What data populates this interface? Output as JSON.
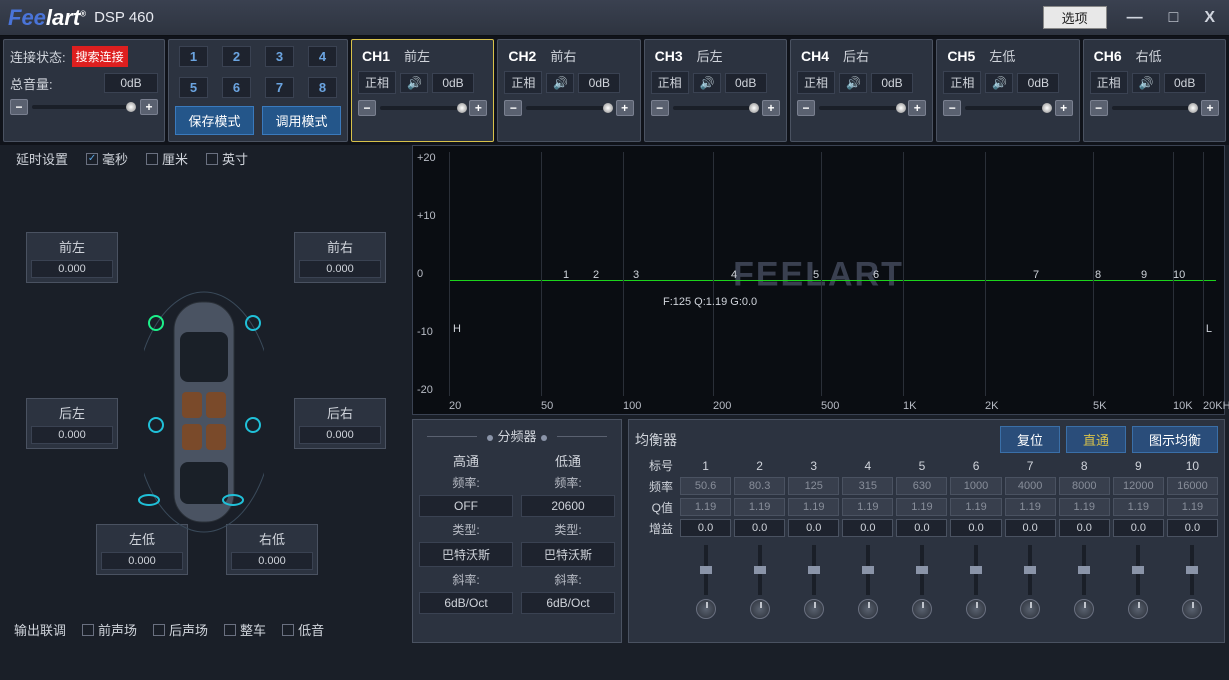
{
  "app": {
    "brand_a": "Fee",
    "brand_b": "lart",
    "product": "DSP 460",
    "options": "选项"
  },
  "win": {
    "min": "—",
    "max": "□",
    "close": "X"
  },
  "status": {
    "label": "连接状态:",
    "search": "搜索连接",
    "vol_label": "总音量:",
    "vol_value": "0dB"
  },
  "presets": {
    "nums": [
      "1",
      "2",
      "3",
      "4",
      "5",
      "6",
      "7",
      "8"
    ],
    "save": "保存模式",
    "recall": "调用模式"
  },
  "channels": [
    {
      "id": "CH1",
      "name": "前左",
      "phase": "正相",
      "db": "0dB",
      "selected": true
    },
    {
      "id": "CH2",
      "name": "前右",
      "phase": "正相",
      "db": "0dB",
      "selected": false
    },
    {
      "id": "CH3",
      "name": "后左",
      "phase": "正相",
      "db": "0dB",
      "selected": false
    },
    {
      "id": "CH4",
      "name": "后右",
      "phase": "正相",
      "db": "0dB",
      "selected": false
    },
    {
      "id": "CH5",
      "name": "左低",
      "phase": "正相",
      "db": "0dB",
      "selected": false
    },
    {
      "id": "CH6",
      "name": "右低",
      "phase": "正相",
      "db": "0dB",
      "selected": false
    }
  ],
  "delay": {
    "title": "延时设置",
    "units": {
      "ms": "毫秒",
      "cm": "厘米",
      "inch": "英寸",
      "selected": "ms"
    },
    "speakers": {
      "fl": {
        "name": "前左",
        "value": "0.000"
      },
      "fr": {
        "name": "前右",
        "value": "0.000"
      },
      "rl": {
        "name": "后左",
        "value": "0.000"
      },
      "rr": {
        "name": "后右",
        "value": "0.000"
      },
      "ll": {
        "name": "左低",
        "value": "0.000"
      },
      "lr": {
        "name": "右低",
        "value": "0.000"
      }
    },
    "link": {
      "label": "输出联调",
      "front": "前声场",
      "rear": "后声场",
      "whole": "整车",
      "bass": "低音"
    }
  },
  "chart_data": {
    "type": "line",
    "title": "",
    "watermark": "FEELART",
    "xlabel": "",
    "ylabel": "",
    "x_scale": "log",
    "xlim": [
      20,
      20000
    ],
    "ylim": [
      -20,
      20
    ],
    "y_ticks": [
      -20,
      -10,
      0,
      10,
      20
    ],
    "x_ticks": [
      "20",
      "50",
      "100",
      "200",
      "500",
      "1K",
      "2K",
      "5K",
      "10K",
      "20KHz"
    ],
    "series": [
      {
        "name": "response",
        "x": [
          20,
          50,
          100,
          200,
          500,
          1000,
          2000,
          5000,
          10000,
          20000
        ],
        "y": [
          0,
          0,
          0,
          0,
          0,
          0,
          0,
          0,
          0,
          0
        ]
      }
    ],
    "markers": {
      "H": "left",
      "L": "right"
    },
    "eq_points": [
      "1",
      "2",
      "3",
      "4",
      "5",
      "6",
      "7",
      "8",
      "9",
      "10"
    ],
    "readout": "F:125 Q:1.19 G:0.0"
  },
  "xover": {
    "title": "分频器",
    "hp": {
      "title": "高通",
      "freq_lbl": "频率:",
      "freq": "OFF",
      "type_lbl": "类型:",
      "type": "巴特沃斯",
      "slope_lbl": "斜率:",
      "slope": "6dB/Oct"
    },
    "lp": {
      "title": "低通",
      "freq_lbl": "频率:",
      "freq": "20600",
      "type_lbl": "类型:",
      "type": "巴特沃斯",
      "slope_lbl": "斜率:",
      "slope": "6dB/Oct"
    }
  },
  "eq": {
    "title": "均衡器",
    "reset": "复位",
    "bypass": "直通",
    "graphic": "图示均衡",
    "row_labels": {
      "num": "标号",
      "freq": "频率",
      "q": "Q值",
      "gain": "增益"
    },
    "bands": [
      {
        "n": "1",
        "freq": "50.6",
        "q": "1.19",
        "gain": "0.0"
      },
      {
        "n": "2",
        "freq": "80.3",
        "q": "1.19",
        "gain": "0.0"
      },
      {
        "n": "3",
        "freq": "125",
        "q": "1.19",
        "gain": "0.0"
      },
      {
        "n": "4",
        "freq": "315",
        "q": "1.19",
        "gain": "0.0"
      },
      {
        "n": "5",
        "freq": "630",
        "q": "1.19",
        "gain": "0.0"
      },
      {
        "n": "6",
        "freq": "1000",
        "q": "1.19",
        "gain": "0.0"
      },
      {
        "n": "7",
        "freq": "4000",
        "q": "1.19",
        "gain": "0.0"
      },
      {
        "n": "8",
        "freq": "8000",
        "q": "1.19",
        "gain": "0.0"
      },
      {
        "n": "9",
        "freq": "12000",
        "q": "1.19",
        "gain": "0.0"
      },
      {
        "n": "10",
        "freq": "16000",
        "q": "1.19",
        "gain": "0.0"
      }
    ]
  }
}
